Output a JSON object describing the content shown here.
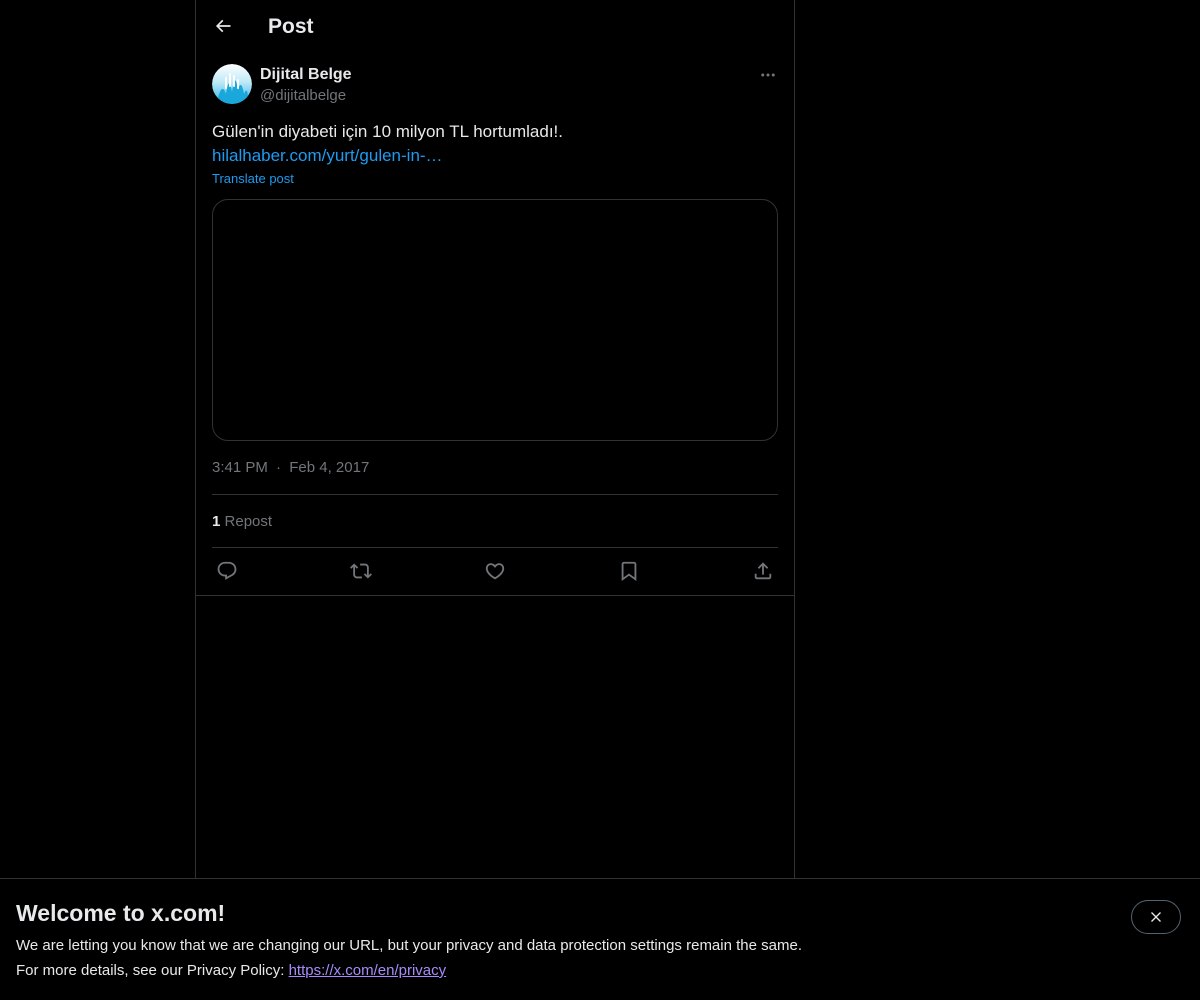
{
  "header": {
    "title": "Post"
  },
  "post": {
    "author": {
      "name": "Dijital Belge",
      "handle": "@dijitalbelge"
    },
    "text": "Gülen'in diyabeti için 10 milyon TL hortumladı!.",
    "link": "hilalhaber.com/yurt/gulen-in-…",
    "translate_label": "Translate post",
    "time": "3:41 PM",
    "separator": "·",
    "date": "Feb 4, 2017",
    "reposts": {
      "count": "1",
      "label": "Repost"
    }
  },
  "banner": {
    "title": "Welcome to x.com!",
    "line1": "We are letting you know that we are changing our URL, but your privacy and data protection settings remain the same.",
    "line2_prefix": "For more details, see our Privacy Policy: ",
    "privacy_link": "https://x.com/en/privacy"
  },
  "colors": {
    "background": "#000000",
    "text_primary": "#e7e9ea",
    "text_secondary": "#71767b",
    "link": "#1d9bf0",
    "border": "#2f3336",
    "banner_link": "#a78bfa"
  },
  "icons": {
    "back": "arrow-left-icon",
    "more": "ellipsis-icon",
    "reply": "speech-bubble-icon",
    "repost": "repost-arrows-icon",
    "like": "heart-icon",
    "bookmark": "bookmark-icon",
    "share": "share-upload-icon",
    "close": "close-x-icon"
  }
}
